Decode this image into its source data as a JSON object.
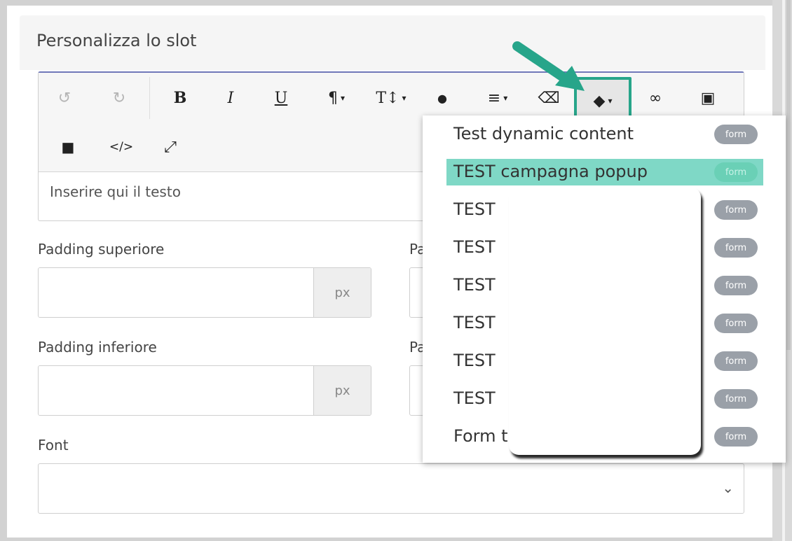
{
  "panel": {
    "title": "Personalizza lo slot"
  },
  "editor": {
    "toolbar": {
      "undo_icon": "↺",
      "redo_icon": "↻",
      "bold_label": "B",
      "italic_label": "I",
      "underline_label": "U",
      "paragraph_icon": "¶",
      "font_size_icon": "T↕",
      "color_icon": "●",
      "align_icon": "≡",
      "eraser_icon": "⌫",
      "tag_icon": "◆",
      "link_icon": "∞",
      "image_icon": "▣",
      "video_icon": "■",
      "code_label": "</>",
      "fullscreen_icon": "⤢",
      "caret": "▾"
    },
    "placeholder_text": "Inserire qui il testo"
  },
  "form": {
    "padding_top_label": "Padding superiore",
    "padding_bottom_label": "Padding inferiore",
    "second_col_top_label": "Pa",
    "second_col_bottom_label": "Pa",
    "unit": "px",
    "font_label": "Font"
  },
  "dropdown": {
    "items": [
      {
        "label": "Test dynamic content",
        "badge": "form"
      },
      {
        "label": "TEST campagna popup",
        "badge": "form"
      },
      {
        "label": "TEST",
        "badge": "form"
      },
      {
        "label": "TEST",
        "badge": "form"
      },
      {
        "label": "TEST",
        "badge": "form"
      },
      {
        "label": "TEST",
        "badge": "form"
      },
      {
        "label": "TEST",
        "badge": "form"
      },
      {
        "label": "TEST",
        "badge": "form"
      },
      {
        "label": "Form t",
        "badge": "form"
      }
    ],
    "active_index": 1
  },
  "colors": {
    "highlight": "#7fd8c6",
    "annotation": "#27a58a",
    "badge": "#9aa0a8"
  }
}
